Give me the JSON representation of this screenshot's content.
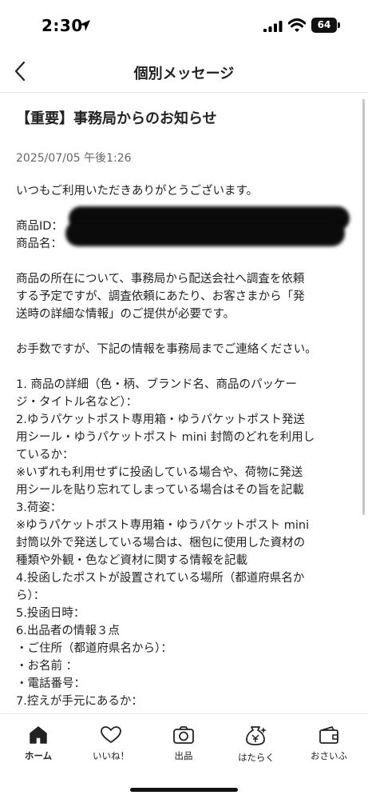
{
  "status_bar": {
    "time": "2:30",
    "battery": "64"
  },
  "header": {
    "title": "個別メッセージ"
  },
  "message": {
    "title": "【重要】事務局からのお知らせ",
    "date": "2025/07/05 午後1:26",
    "greeting": "いつもご利用いただきありがとうございます。",
    "product_id_label": "商品ID：",
    "product_name_label": "商品名：",
    "para1": [
      "商品の所在について、事務局から配送会社へ調査を依頼",
      "する予定ですが、調査依頼にあたり、お客さまから「発",
      "送時の詳細な情報」のご提供が必要です。"
    ],
    "para2": "お手数ですが、下記の情報を事務局までご連絡ください。",
    "list": [
      "1. 商品の詳細（色・柄、ブランド名、商品のパッケー",
      "ジ・タイトル名など）：",
      "2.ゆうパケットポスト専用箱・ゆうパケットポスト発送",
      "用シール・ゆうパケットポスト mini 封筒のどれを利用し",
      "ているか：",
      "※いずれも利用せずに投函している場合や、荷物に発送",
      "用シールを貼り忘れてしまっている場合はその旨を記載",
      "3.荷姿：",
      "※ゆうパケットポスト専用箱・ゆうパケットポスト mini",
      "封筒以外で発送している場合は、梱包に使用した資材の",
      "種類や外観・色など資材に関する情報を記載",
      "4.投函したポストが設置されている場所（都道府県名か",
      "ら）：",
      "5.投函日時：",
      "6.出品者の情報３点",
      "・ご住所（都道府県名から）：",
      "・お名前 ：",
      "・電話番号：",
      "7.控えが手元にあるか："
    ]
  },
  "tabs": [
    {
      "label": "ホーム",
      "icon": "home-icon"
    },
    {
      "label": "いいね！",
      "icon": "heart-icon"
    },
    {
      "label": "出品",
      "icon": "camera-icon"
    },
    {
      "label": "はたらく",
      "icon": "money-bag-icon"
    },
    {
      "label": "おさいふ",
      "icon": "wallet-icon"
    }
  ]
}
